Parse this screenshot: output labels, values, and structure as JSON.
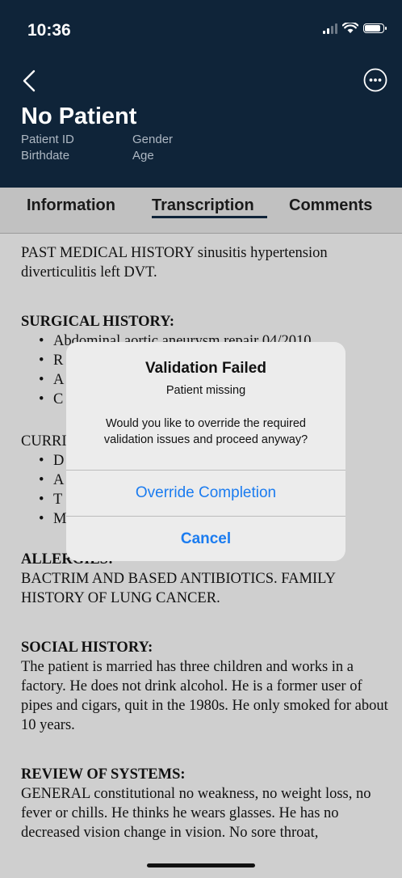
{
  "status": {
    "time": "10:36"
  },
  "header": {
    "patient_name": "No Patient",
    "labels": {
      "patient_id": "Patient ID",
      "gender": "Gender",
      "birthdate": "Birthdate",
      "age": "Age"
    }
  },
  "icons": {
    "back": "chevron-left-icon",
    "more": "ellipsis-circle-icon"
  },
  "tabs": [
    {
      "label": "Information",
      "active": false
    },
    {
      "label": "Transcription",
      "active": true
    },
    {
      "label": "Comments",
      "active": false
    }
  ],
  "transcript": {
    "past_medical": "PAST MEDICAL HISTORY sinusitis hypertension diverticulitis left DVT.",
    "surgical_heading": "SURGICAL HISTORY:",
    "surgical_items": [
      "Abdominal aortic aneurysm repair 04/2010.",
      "R",
      "A",
      "C"
    ],
    "current_heading": "CURRI",
    "current_items": [
      "D",
      "A",
      "T",
      "M"
    ],
    "allergies_heading": "ALLERGIES:",
    "allergies": "BACTRIM AND BASED ANTIBIOTICS. FAMILY HISTORY OF LUNG CANCER.",
    "social_heading": "SOCIAL HISTORY:",
    "social": "The patient is married has three children and works in a factory. He does not drink alcohol. He is a former user of pipes and cigars, quit in the 1980s. He only smoked for about 10 years.",
    "ros_heading": "REVIEW OF SYSTEMS:",
    "ros": "GENERAL constitutional no weakness, no weight loss, no fever or chills. He thinks he wears glasses. He has no decreased vision change in vision. No sore throat,"
  },
  "dialog": {
    "title": "Validation Failed",
    "subtitle": "Patient missing",
    "message": "Would you like to override the required validation issues and proceed anyway?",
    "primary": "Override Completion",
    "cancel": "Cancel"
  },
  "colors": {
    "header_bg": "#0f2439",
    "accent": "#1b7cf0"
  }
}
